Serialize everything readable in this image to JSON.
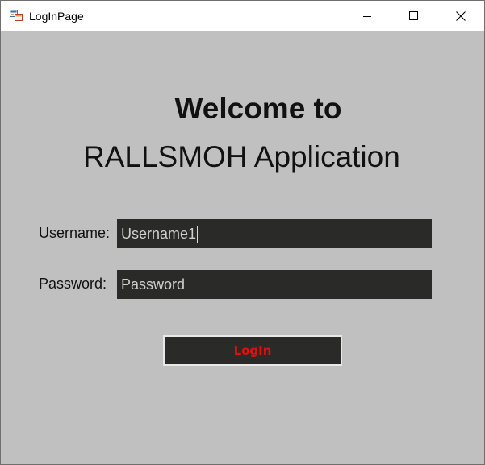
{
  "window": {
    "title": "LogInPage",
    "icon": "form-icon"
  },
  "controls": {
    "minimize": "minimize-icon",
    "maximize": "maximize-icon",
    "close": "close-icon"
  },
  "heading": {
    "line1": "Welcome to",
    "line2": "RALLSMOH Application"
  },
  "form": {
    "username_label": "Username:",
    "username_value": "Username1",
    "password_label": "Password:",
    "password_value": "Password",
    "login_label": "LogIn"
  },
  "colors": {
    "background": "#c0c0c0",
    "input_background": "#2a2a28",
    "login_text": "#e01010"
  }
}
